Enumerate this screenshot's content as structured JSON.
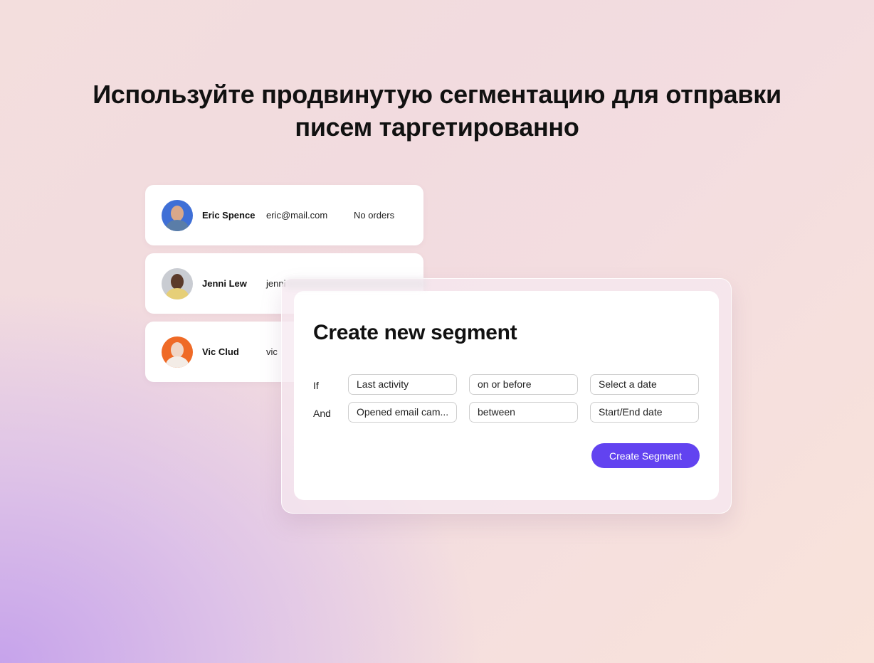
{
  "headline": {
    "line1": "Используйте продвинутую сегментацию для отправки",
    "line2": "писем таргетированно"
  },
  "contacts": [
    {
      "name": "Eric Spence",
      "email": "eric@mail.com",
      "orders": "No orders",
      "avatar_bg": "#3f6fd6"
    },
    {
      "name": "Jenni Lew",
      "email": "jenni",
      "orders": "",
      "avatar_bg": "#c9ccd2"
    },
    {
      "name": "Vic Clud",
      "email": "vic",
      "orders": "",
      "avatar_bg": "#ef6a26"
    }
  ],
  "segment_modal": {
    "title": "Create new segment",
    "rows": [
      {
        "label": "If",
        "field": "Last activity",
        "operator": "on or before",
        "value": "Select a date"
      },
      {
        "label": "And",
        "field": "Opened email cam...",
        "operator": "between",
        "value": "Start/End date"
      }
    ],
    "create_button": "Create Segment",
    "accent_color": "#6243f0"
  }
}
